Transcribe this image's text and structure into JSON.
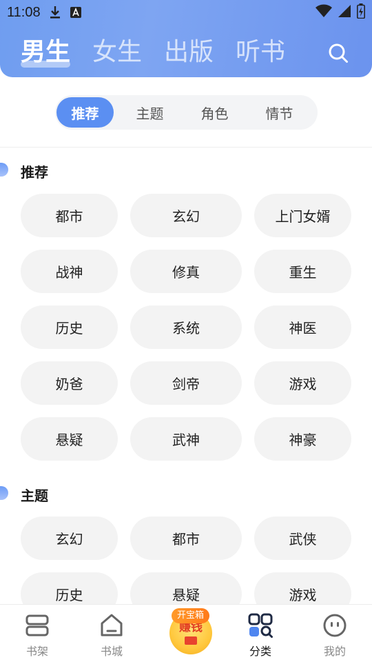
{
  "status_bar": {
    "time": "11:08"
  },
  "header": {
    "gender_tabs": [
      {
        "label": "男生",
        "active": true
      },
      {
        "label": "女生",
        "active": false
      },
      {
        "label": "出版",
        "active": false
      },
      {
        "label": "听书",
        "active": false
      }
    ]
  },
  "segment_tabs": [
    {
      "label": "推荐",
      "active": true
    },
    {
      "label": "主题",
      "active": false
    },
    {
      "label": "角色",
      "active": false
    },
    {
      "label": "情节",
      "active": false
    }
  ],
  "sections": [
    {
      "title": "推荐",
      "tags": [
        "都市",
        "玄幻",
        "上门女婿",
        "战神",
        "修真",
        "重生",
        "历史",
        "系统",
        "神医",
        "奶爸",
        "剑帝",
        "游戏",
        "悬疑",
        "武神",
        "神豪"
      ]
    },
    {
      "title": "主题",
      "tags": [
        "玄幻",
        "都市",
        "武侠",
        "历史",
        "悬疑",
        "游戏"
      ]
    }
  ],
  "bottom_nav": {
    "items": [
      {
        "label": "书架",
        "icon": "bookshelf-icon",
        "active": false
      },
      {
        "label": "书城",
        "icon": "home-icon",
        "active": false
      },
      {
        "label": "赚钱",
        "icon": "coin-icon",
        "badge": "开宝箱",
        "active": false
      },
      {
        "label": "分类",
        "icon": "category-icon",
        "active": true
      },
      {
        "label": "我的",
        "icon": "profile-icon",
        "active": false
      }
    ]
  },
  "colors": {
    "accent": "#5b8ff2",
    "header_start": "#6f9df0",
    "header_end": "#6b93ee",
    "chip_bg": "#f3f3f3",
    "badge": "#ff8a22"
  }
}
